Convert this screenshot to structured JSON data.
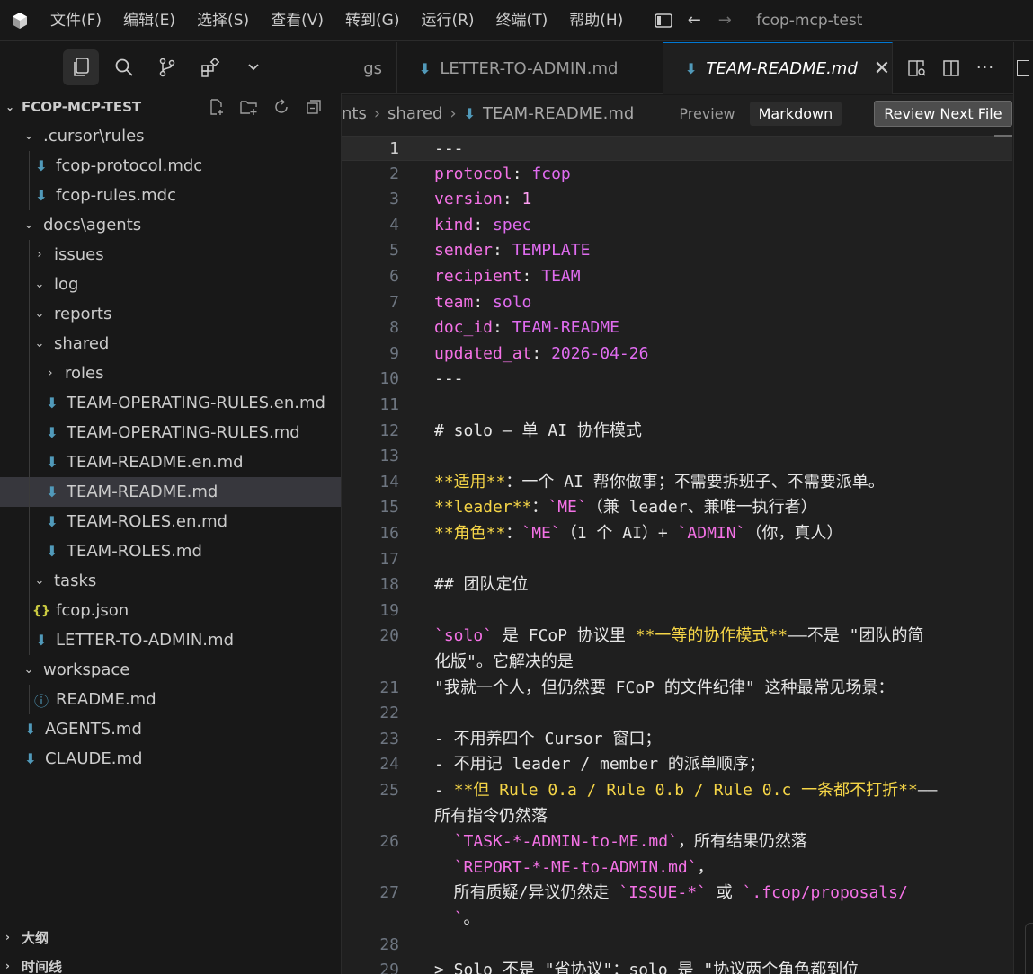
{
  "titlebar": {
    "menus": [
      "文件(F)",
      "编辑(E)",
      "选择(S)",
      "查看(V)",
      "转到(G)",
      "运行(R)",
      "终端(T)",
      "帮助(H)"
    ],
    "window_title": "fcop-mcp-test"
  },
  "explorer": {
    "title": "FCOP-MCP-TEST",
    "tree": [
      {
        "label": ".cursor\\rules",
        "type": "folder",
        "open": true,
        "depth": 1
      },
      {
        "label": "fcop-protocol.mdc",
        "type": "md",
        "depth": 2
      },
      {
        "label": "fcop-rules.mdc",
        "type": "md",
        "depth": 2
      },
      {
        "label": "docs\\agents",
        "type": "folder",
        "open": true,
        "depth": 1
      },
      {
        "label": "issues",
        "type": "folder",
        "open": false,
        "depth": 2
      },
      {
        "label": "log",
        "type": "folder",
        "open": true,
        "depth": 2
      },
      {
        "label": "reports",
        "type": "folder",
        "open": true,
        "depth": 2
      },
      {
        "label": "shared",
        "type": "folder",
        "open": true,
        "depth": 2
      },
      {
        "label": "roles",
        "type": "folder",
        "open": false,
        "depth": 3
      },
      {
        "label": "TEAM-OPERATING-RULES.en.md",
        "type": "md",
        "depth": 3
      },
      {
        "label": "TEAM-OPERATING-RULES.md",
        "type": "md",
        "depth": 3
      },
      {
        "label": "TEAM-README.en.md",
        "type": "md",
        "depth": 3
      },
      {
        "label": "TEAM-README.md",
        "type": "md",
        "depth": 3,
        "selected": true
      },
      {
        "label": "TEAM-ROLES.en.md",
        "type": "md",
        "depth": 3
      },
      {
        "label": "TEAM-ROLES.md",
        "type": "md",
        "depth": 3
      },
      {
        "label": "tasks",
        "type": "folder",
        "open": true,
        "depth": 2
      },
      {
        "label": "fcop.json",
        "type": "json",
        "depth": 2
      },
      {
        "label": "LETTER-TO-ADMIN.md",
        "type": "md",
        "depth": 2
      },
      {
        "label": "workspace",
        "type": "folder",
        "open": true,
        "depth": 1
      },
      {
        "label": "README.md",
        "type": "info",
        "depth": 2
      },
      {
        "label": "AGENTS.md",
        "type": "md",
        "depth": 1
      },
      {
        "label": "CLAUDE.md",
        "type": "md",
        "depth": 1
      }
    ],
    "outline_label": "大纲",
    "timeline_label": "时间线"
  },
  "tabs": {
    "partial": "gs",
    "inactive": "LETTER-TO-ADMIN.md",
    "active": "TEAM-README.md",
    "close_glyph": "✕"
  },
  "breadcrumb": {
    "parts": [
      "nts",
      "shared",
      "TEAM-README.md"
    ],
    "preview": "Preview",
    "markdown": "Markdown",
    "review": "Review Next File"
  },
  "editor": {
    "current_line": 1,
    "lines": [
      {
        "n": "1",
        "segs": [
          [
            "h",
            "---"
          ]
        ]
      },
      {
        "n": "2",
        "segs": [
          [
            "k",
            "protocol"
          ],
          [
            "h",
            ": "
          ],
          [
            "v",
            "fcop"
          ]
        ]
      },
      {
        "n": "3",
        "segs": [
          [
            "k",
            "version"
          ],
          [
            "h",
            ": "
          ],
          [
            "n",
            "1"
          ]
        ]
      },
      {
        "n": "4",
        "segs": [
          [
            "k",
            "kind"
          ],
          [
            "h",
            ": "
          ],
          [
            "v",
            "spec"
          ]
        ]
      },
      {
        "n": "5",
        "segs": [
          [
            "k",
            "sender"
          ],
          [
            "h",
            ": "
          ],
          [
            "v",
            "TEMPLATE"
          ]
        ]
      },
      {
        "n": "6",
        "segs": [
          [
            "k",
            "recipient"
          ],
          [
            "h",
            ": "
          ],
          [
            "v",
            "TEAM"
          ]
        ]
      },
      {
        "n": "7",
        "segs": [
          [
            "k",
            "team"
          ],
          [
            "h",
            ": "
          ],
          [
            "v",
            "solo"
          ]
        ]
      },
      {
        "n": "8",
        "segs": [
          [
            "k",
            "doc_id"
          ],
          [
            "h",
            ": "
          ],
          [
            "v",
            "TEAM-README"
          ]
        ]
      },
      {
        "n": "9",
        "segs": [
          [
            "k",
            "updated_at"
          ],
          [
            "h",
            ": "
          ],
          [
            "v",
            "2026-04-26"
          ]
        ]
      },
      {
        "n": "10",
        "segs": [
          [
            "h",
            "---"
          ]
        ]
      },
      {
        "n": "11",
        "segs": []
      },
      {
        "n": "12",
        "segs": [
          [
            "h",
            "# solo — 单 AI 协作模式"
          ]
        ]
      },
      {
        "n": "13",
        "segs": []
      },
      {
        "n": "14",
        "segs": [
          [
            "b",
            "**适用**"
          ],
          [
            "h",
            "：一个 AI 帮你做事；不需要拆班子、不需要派单。"
          ]
        ]
      },
      {
        "n": "15",
        "segs": [
          [
            "b",
            "**leader**"
          ],
          [
            "h",
            "："
          ],
          [
            "c",
            "`ME`"
          ],
          [
            "h",
            "（兼 leader、兼唯一执行者）"
          ]
        ]
      },
      {
        "n": "16",
        "segs": [
          [
            "b",
            "**角色**"
          ],
          [
            "h",
            "："
          ],
          [
            "c",
            "`ME`"
          ],
          [
            "h",
            "（1 个 AI）+ "
          ],
          [
            "c",
            "`ADMIN`"
          ],
          [
            "h",
            "（你，真人）"
          ]
        ]
      },
      {
        "n": "17",
        "segs": []
      },
      {
        "n": "18",
        "segs": [
          [
            "h",
            "## 团队定位"
          ]
        ]
      },
      {
        "n": "19",
        "segs": []
      },
      {
        "n": "20",
        "segs": [
          [
            "c",
            "`solo`"
          ],
          [
            "h",
            " 是 FCoP 协议里 "
          ],
          [
            "b",
            "**一等的协作模式**"
          ],
          [
            "h",
            "——不是 \"团队的简"
          ]
        ]
      },
      {
        "n": "",
        "segs": [
          [
            "h",
            "化版\"。它解决的是"
          ]
        ]
      },
      {
        "n": "21",
        "segs": [
          [
            "h",
            "\"我就一个人，但仍然要 FCoP 的文件纪律\" 这种最常见场景："
          ]
        ]
      },
      {
        "n": "22",
        "segs": []
      },
      {
        "n": "23",
        "segs": [
          [
            "h",
            "- 不用养四个 Cursor 窗口；"
          ]
        ]
      },
      {
        "n": "24",
        "segs": [
          [
            "h",
            "- 不用记 leader / member 的派单顺序；"
          ]
        ]
      },
      {
        "n": "25",
        "segs": [
          [
            "h",
            "- "
          ],
          [
            "b",
            "**但 Rule 0.a / Rule 0.b / Rule 0.c 一条都不打折**"
          ],
          [
            "h",
            "——"
          ]
        ]
      },
      {
        "n": "",
        "segs": [
          [
            "h",
            "所有指令仍然落"
          ]
        ]
      },
      {
        "n": "26",
        "segs": [
          [
            "h",
            "  "
          ],
          [
            "c",
            "`TASK-*-ADMIN-to-ME.md`"
          ],
          [
            "h",
            "，所有结果仍然落"
          ]
        ]
      },
      {
        "n": "",
        "segs": [
          [
            "h",
            "  "
          ],
          [
            "c",
            "`REPORT-*-ME-to-ADMIN.md`"
          ],
          [
            "h",
            "，"
          ]
        ]
      },
      {
        "n": "27",
        "segs": [
          [
            "h",
            "  所有质疑/异议仍然走 "
          ],
          [
            "c",
            "`ISSUE-*`"
          ],
          [
            "h",
            " 或 "
          ],
          [
            "c",
            "`.fcop/proposals/"
          ]
        ]
      },
      {
        "n": "",
        "segs": [
          [
            "h",
            "  "
          ],
          [
            "c",
            "`"
          ],
          [
            "h",
            "。"
          ]
        ]
      },
      {
        "n": "28",
        "segs": []
      },
      {
        "n": "29",
        "segs": [
          [
            "h",
            "> Solo 不是 \"省协议\"：solo 是 \"协议两个角色都到位"
          ]
        ]
      }
    ]
  }
}
